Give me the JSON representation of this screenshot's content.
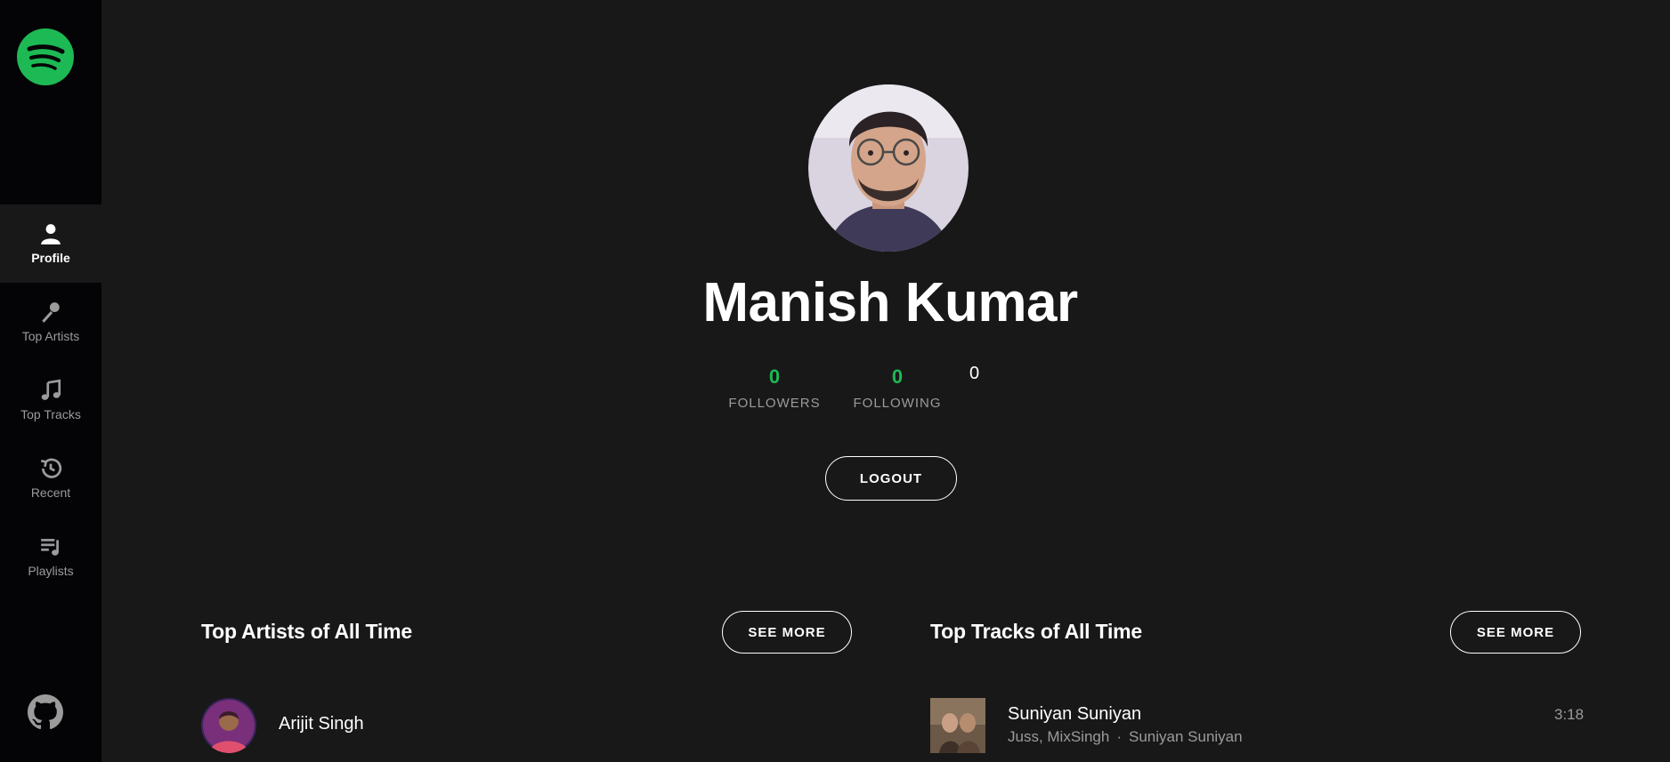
{
  "sidebar": {
    "logo_icon": "spotify-logo",
    "items": [
      {
        "label": "Profile",
        "icon": "user-icon",
        "active": true
      },
      {
        "label": "Top Artists",
        "icon": "microphone-icon",
        "active": false
      },
      {
        "label": "Top Tracks",
        "icon": "music-note-icon",
        "active": false
      },
      {
        "label": "Recent",
        "icon": "history-icon",
        "active": false
      },
      {
        "label": "Playlists",
        "icon": "playlist-icon",
        "active": false
      }
    ],
    "github_icon": "github-icon"
  },
  "profile": {
    "name": "Manish Kumar",
    "stats": [
      {
        "value": "0",
        "label": "FOLLOWERS"
      },
      {
        "value": "0",
        "label": "FOLLOWING"
      },
      {
        "value": "0",
        "label": ""
      }
    ],
    "logout_label": "LOGOUT"
  },
  "top_artists": {
    "title": "Top Artists of All Time",
    "see_more_label": "SEE MORE",
    "items": [
      {
        "name": "Arijit Singh"
      }
    ]
  },
  "top_tracks": {
    "title": "Top Tracks of All Time",
    "see_more_label": "SEE MORE",
    "items": [
      {
        "name": "Suniyan Suniyan",
        "artists": "Juss, MixSingh",
        "separator": "·",
        "album": "Suniyan Suniyan",
        "duration": "3:18"
      }
    ]
  },
  "colors": {
    "accent": "#1db954",
    "background": "#181818",
    "sidebar": "#040306",
    "muted_text": "#9b9b9b"
  }
}
